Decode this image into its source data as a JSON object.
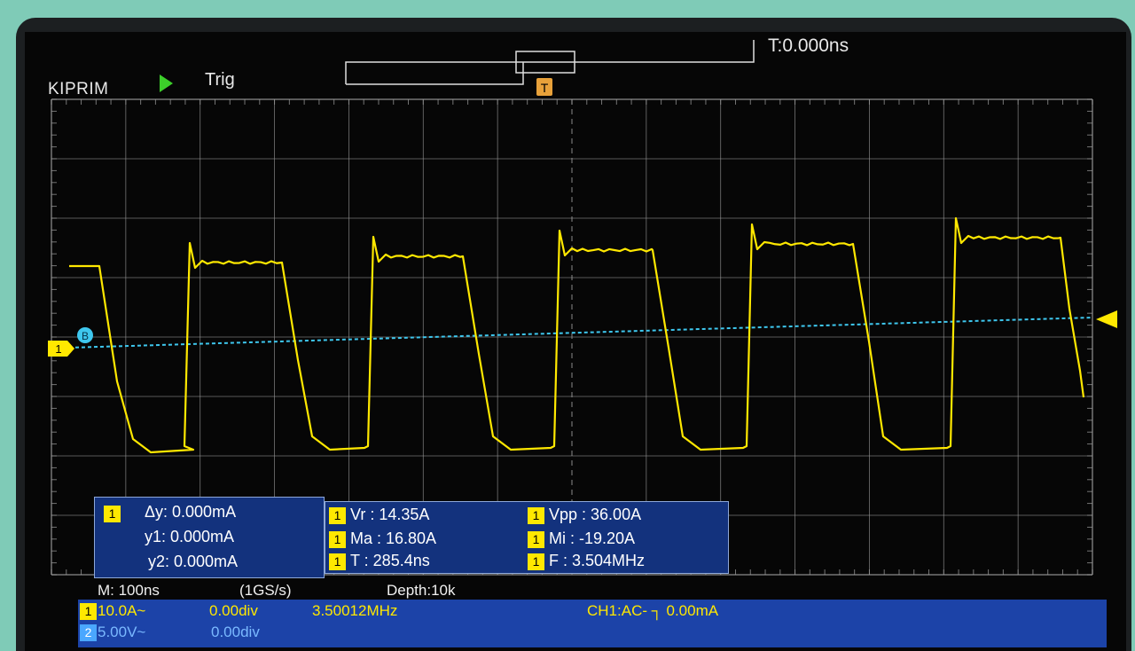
{
  "header": {
    "brand": "KIPRIM",
    "trigger_status": "Trig",
    "time_position": "T:0.000ns",
    "trigger_marker": "T"
  },
  "markers": {
    "ch1_ref": "1",
    "ch2_ref": "B"
  },
  "cursor_panel": {
    "channel": "1",
    "dy": "Δy: 0.000mA",
    "y1": "y1: 0.000mA",
    "y2": "y2: 0.000mA"
  },
  "measurements": [
    {
      "channel": "1",
      "text": "Vr : 14.35A"
    },
    {
      "channel": "1",
      "text": "Vpp : 36.00A"
    },
    {
      "channel": "1",
      "text": "Ma : 16.80A"
    },
    {
      "channel": "1",
      "text": "Mi : -19.20A"
    },
    {
      "channel": "1",
      "text": "T : 285.4ns"
    },
    {
      "channel": "1",
      "text": "F : 3.504MHz"
    }
  ],
  "status_line": {
    "timebase": "M: 100ns",
    "sample_rate": "(1GS/s)",
    "depth": "Depth:10k"
  },
  "channel_bar": {
    "ch1": {
      "num": "1",
      "scale": "10.0A~",
      "offset": "0.00div",
      "freq": "3.50012MHz"
    },
    "ch2": {
      "num": "2",
      "scale": "5.00V~",
      "offset": "0.00div"
    },
    "trigger": "CH1:AC- ┐ 0.00mA"
  },
  "colors": {
    "ch1": "#ffe800",
    "ch2": "#3ec7ee",
    "grid": "#9a9a9a",
    "panel": "#13327d"
  }
}
